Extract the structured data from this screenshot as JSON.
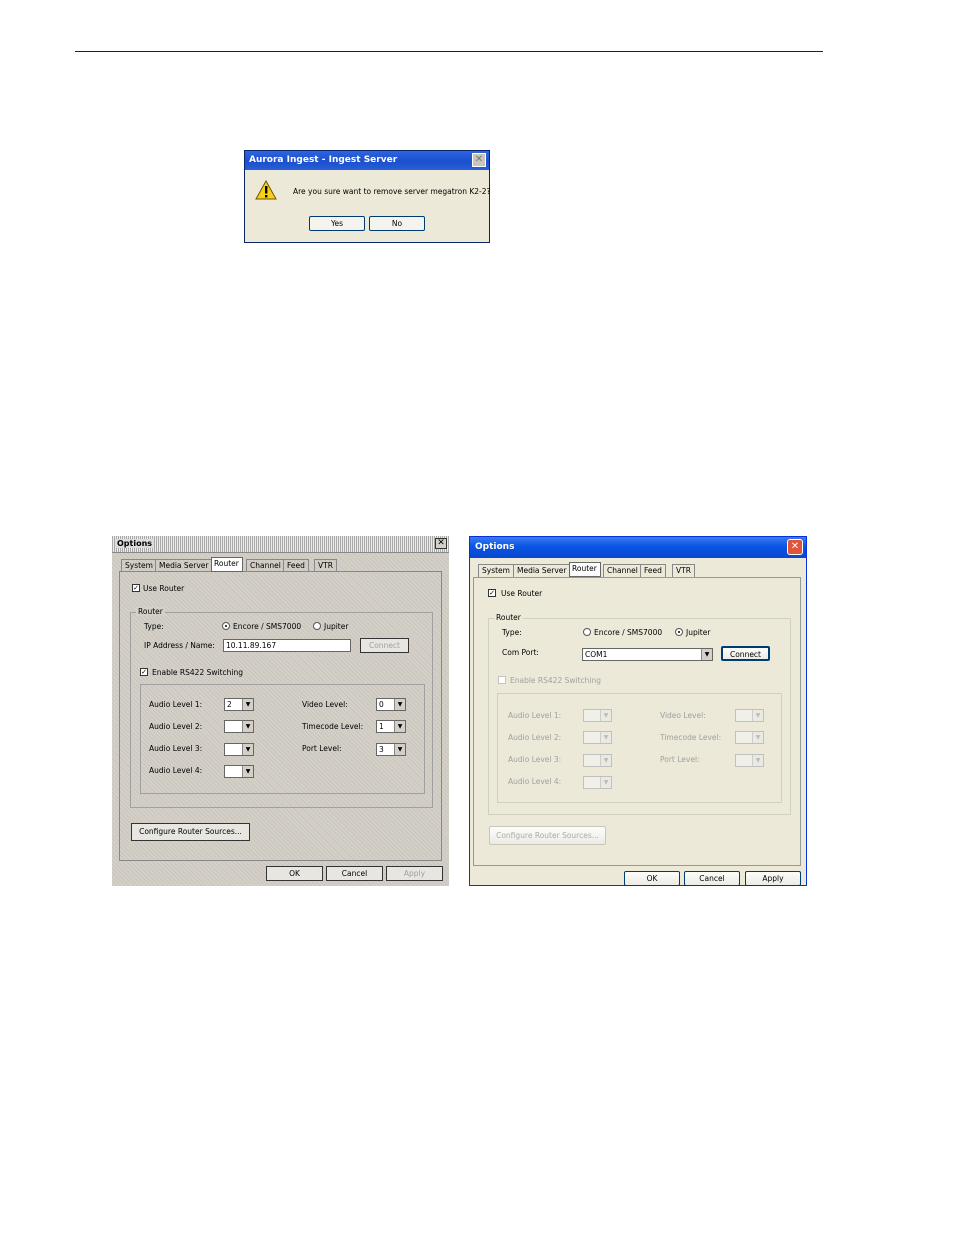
{
  "confirm_dialog": {
    "title": "Aurora Ingest - Ingest Server",
    "message": "Are you sure want to remove server megatron K2-2?",
    "yes_label": "Yes",
    "no_label": "No",
    "close_glyph": "✕",
    "icon": "warning-icon"
  },
  "options_classic": {
    "title": "Options",
    "close_glyph": "✕",
    "tabs": [
      "System",
      "Media Server",
      "Router",
      "Channel",
      "Feed",
      "VTR"
    ],
    "selected_tab": "Router",
    "use_router_label": "Use Router",
    "router_group_label": "Router",
    "type_label": "Type:",
    "type_option_1": "Encore / SMS7000",
    "type_option_2": "Jupiter",
    "ip_label": "IP Address / Name:",
    "ip_value": "10.11.89.167",
    "connect_label": "Connect",
    "rs422_label": "Enable RS422 Switching",
    "audio_level_1_label": "Audio Level 1:",
    "audio_level_1_value": "2",
    "audio_level_2_label": "Audio Level 2:",
    "audio_level_2_value": "",
    "audio_level_3_label": "Audio Level 3:",
    "audio_level_3_value": "",
    "audio_level_4_label": "Audio Level 4:",
    "audio_level_4_value": "",
    "video_level_label": "Video Level:",
    "video_level_value": "0",
    "timecode_level_label": "Timecode Level:",
    "timecode_level_value": "1",
    "port_level_label": "Port Level:",
    "port_level_value": "3",
    "configure_label": "Configure Router Sources...",
    "ok_label": "OK",
    "cancel_label": "Cancel",
    "apply_label": "Apply"
  },
  "options_xp": {
    "title": "Options",
    "close_glyph": "✕",
    "tabs": [
      "System",
      "Media Server",
      "Router",
      "Channel",
      "Feed",
      "VTR"
    ],
    "selected_tab": "Router",
    "use_router_label": "Use Router",
    "router_group_label": "Router",
    "type_label": "Type:",
    "type_option_1": "Encore / SMS7000",
    "type_option_2": "Jupiter",
    "com_port_label": "Com Port:",
    "com_port_value": "COM1",
    "connect_label": "Connect",
    "rs422_label": "Enable RS422 Switching",
    "audio_level_1_label": "Audio Level 1:",
    "audio_level_2_label": "Audio Level 2:",
    "audio_level_3_label": "Audio Level 3:",
    "audio_level_4_label": "Audio Level 4:",
    "video_level_label": "Video Level:",
    "timecode_level_label": "Timecode Level:",
    "port_level_label": "Port Level:",
    "configure_label": "Configure Router Sources...",
    "ok_label": "OK",
    "cancel_label": "Cancel",
    "apply_label": "Apply"
  }
}
